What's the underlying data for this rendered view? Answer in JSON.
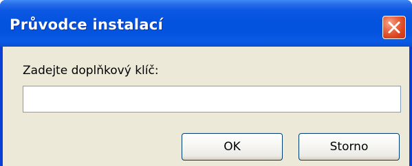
{
  "window": {
    "title": "Průvodce instalací"
  },
  "form": {
    "label": "Zadejte doplňkový klíč:",
    "key_value": "",
    "key_placeholder": ""
  },
  "buttons": {
    "ok_label": "OK",
    "cancel_label": "Storno"
  },
  "icons": {
    "close": "close-icon"
  },
  "colors": {
    "titlebar": "#0453de",
    "client_bg": "#ece9d8",
    "close_button": "#d9421d"
  }
}
